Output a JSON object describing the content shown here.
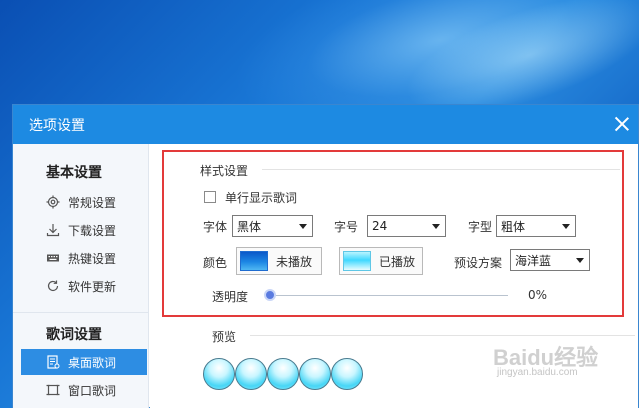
{
  "dialog": {
    "title": "选项设置"
  },
  "sidebar": {
    "basic_heading": "基本设置",
    "basic_items": [
      {
        "label": "常规设置",
        "icon": "gear-icon"
      },
      {
        "label": "下载设置",
        "icon": "download-icon"
      },
      {
        "label": "热键设置",
        "icon": "keyboard-icon"
      },
      {
        "label": "软件更新",
        "icon": "refresh-icon"
      }
    ],
    "lyrics_heading": "歌词设置",
    "lyrics_items": [
      {
        "label": "桌面歌词",
        "icon": "desktop-lyrics-icon",
        "active": true
      },
      {
        "label": "窗口歌词",
        "icon": "window-lyrics-icon",
        "active": false
      }
    ]
  },
  "style_section": {
    "title": "样式设置",
    "single_line_checkbox": {
      "label": "单行显示歌词",
      "checked": false
    },
    "font": {
      "label": "字体",
      "value": "黑体"
    },
    "size": {
      "label": "字号",
      "value": "24"
    },
    "weight": {
      "label": "字型",
      "value": "粗体"
    },
    "color": {
      "label": "颜色",
      "unplayed": "未播放",
      "played": "已播放"
    },
    "preset": {
      "label": "预设方案",
      "value": "海洋蓝"
    },
    "opacity": {
      "label": "透明度",
      "value": "0%",
      "level": 0
    }
  },
  "preview_section": {
    "title": "预览",
    "bubble_count": 5
  },
  "watermark": {
    "text": "Baidu经验",
    "sub": "jingyan.baidu.com"
  },
  "colors": {
    "titlebar": "#1d8ae2",
    "active_item": "#2d8de3",
    "highlight_border": "#e33a3a",
    "slider_thumb": "#5a7be0"
  }
}
